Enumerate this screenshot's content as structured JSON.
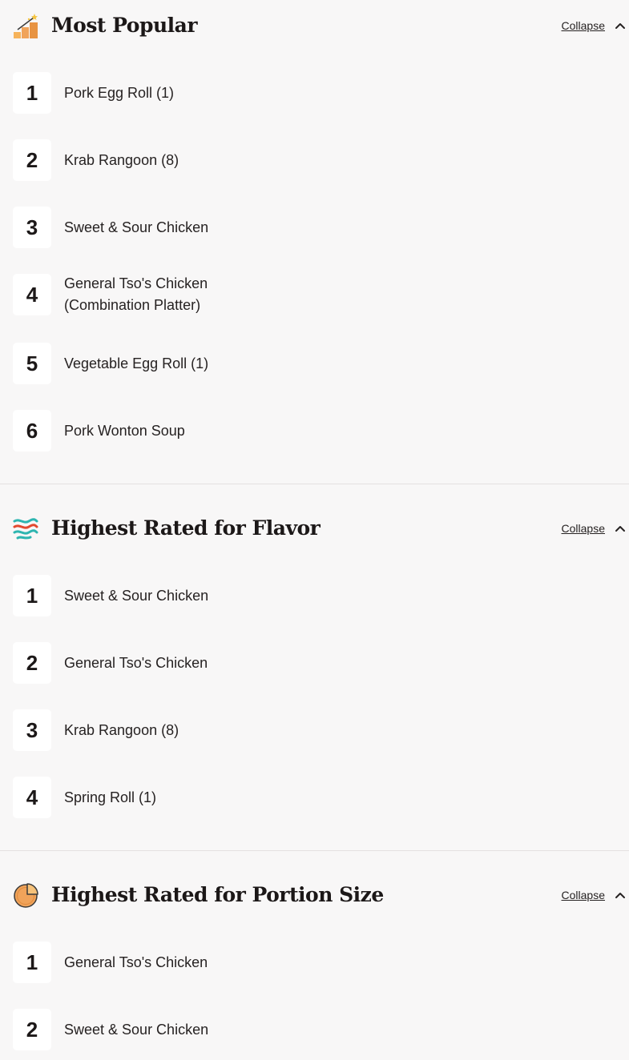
{
  "sections": [
    {
      "title": "Most Popular",
      "icon": "podium-stars-icon",
      "collapse_label": "Collapse",
      "items": [
        {
          "rank": "1",
          "name": "Pork Egg Roll (1)"
        },
        {
          "rank": "2",
          "name": "Krab Rangoon (8)"
        },
        {
          "rank": "3",
          "name": "Sweet & Sour Chicken"
        },
        {
          "rank": "4",
          "name": "General Tso's Chicken (Combination Platter)"
        },
        {
          "rank": "5",
          "name": "Vegetable Egg Roll (1)"
        },
        {
          "rank": "6",
          "name": "Pork Wonton Soup"
        }
      ]
    },
    {
      "title": "Highest Rated for Flavor",
      "icon": "flavor-waves-icon",
      "collapse_label": "Collapse",
      "items": [
        {
          "rank": "1",
          "name": "Sweet & Sour Chicken"
        },
        {
          "rank": "2",
          "name": "General Tso's Chicken"
        },
        {
          "rank": "3",
          "name": "Krab Rangoon (8)"
        },
        {
          "rank": "4",
          "name": "Spring Roll (1)"
        }
      ]
    },
    {
      "title": "Highest Rated for Portion Size",
      "icon": "pie-portion-icon",
      "collapse_label": "Collapse",
      "items": [
        {
          "rank": "1",
          "name": "General Tso's Chicken"
        },
        {
          "rank": "2",
          "name": "Sweet & Sour Chicken"
        }
      ]
    }
  ],
  "colors": {
    "background": "#f8f7f7",
    "rank_box": "#ffffff",
    "text": "#262222",
    "divider": "#e4e1e1",
    "accent_orange": "#f0a35a",
    "accent_teal": "#2db5b0",
    "accent_red": "#e2492f"
  }
}
